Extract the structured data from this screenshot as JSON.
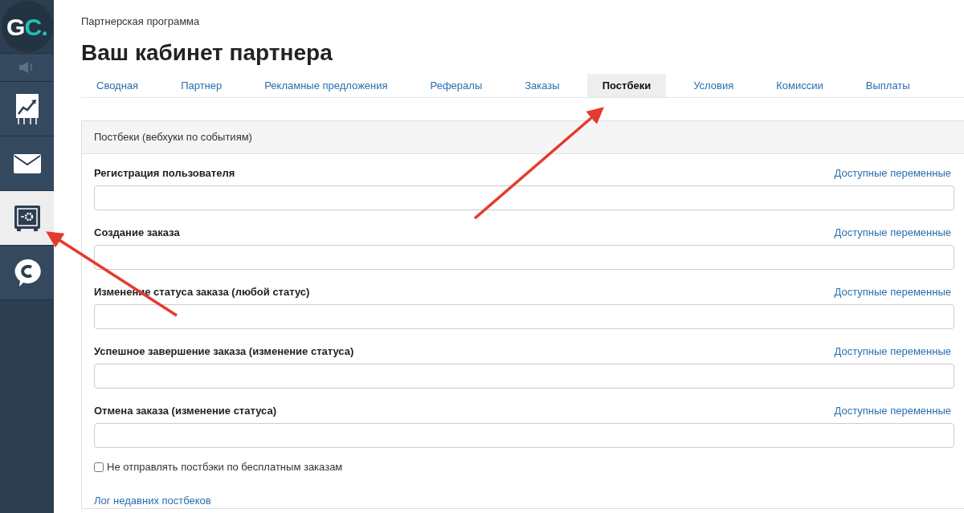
{
  "sidebar": {
    "logo": [
      "G",
      "C."
    ],
    "items": [
      {
        "kind": "sound",
        "selected": false
      },
      {
        "kind": "chart",
        "selected": false
      },
      {
        "kind": "mail",
        "selected": false
      },
      {
        "kind": "safe",
        "selected": true
      },
      {
        "kind": "chat",
        "selected": false
      }
    ]
  },
  "breadcrumb": "Партнерская программа",
  "title": "Ваш кабинет партнера",
  "tabs": [
    {
      "label": "Сводная",
      "selected": false
    },
    {
      "label": "Партнер",
      "selected": false
    },
    {
      "label": "Рекламные предложения",
      "selected": false
    },
    {
      "label": "Рефералы",
      "selected": false
    },
    {
      "label": "Заказы",
      "selected": false
    },
    {
      "label": "Постбеки",
      "selected": true
    },
    {
      "label": "Условия",
      "selected": false
    },
    {
      "label": "Комиссии",
      "selected": false
    },
    {
      "label": "Выплаты",
      "selected": false
    }
  ],
  "panel": {
    "heading": "Постбеки (вебхуки по событиям)",
    "fields": [
      {
        "label": "Регистрация пользователя",
        "link": "Доступные переменные"
      },
      {
        "label": "Создание заказа",
        "link": "Доступные переменные"
      },
      {
        "label": "Изменение статуса заказа (любой статус)",
        "link": "Доступные переменные"
      },
      {
        "label": "Успешное завершение заказа (изменение статуса)",
        "link": "Доступные переменные"
      },
      {
        "label": "Отмена заказа (изменение статуса)",
        "link": "Доступные переменные"
      }
    ],
    "checkbox": {
      "label": "Не отправлять постбэки по бесплатным заказам",
      "checked": false
    },
    "log_link": "Лог недавних постбеков"
  }
}
